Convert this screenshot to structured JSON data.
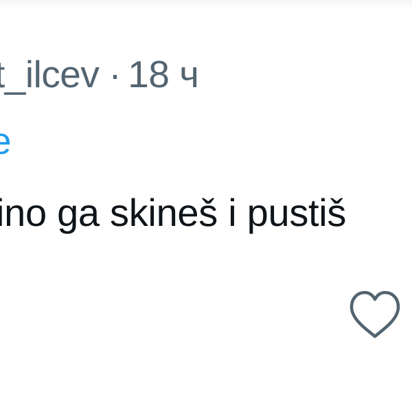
{
  "reply": {
    "username_fragment": "t_ilcev",
    "separator": "·",
    "time": "18 ч"
  },
  "mention_fragment": "e",
  "body_text": "ino ga skineš i pustiš",
  "actions": {
    "like_icon": "heart-outline-icon",
    "like_color": "#536471"
  },
  "colors": {
    "secondary_text": "#536471",
    "link": "#1d9bf0",
    "primary_text": "#0f1419"
  }
}
